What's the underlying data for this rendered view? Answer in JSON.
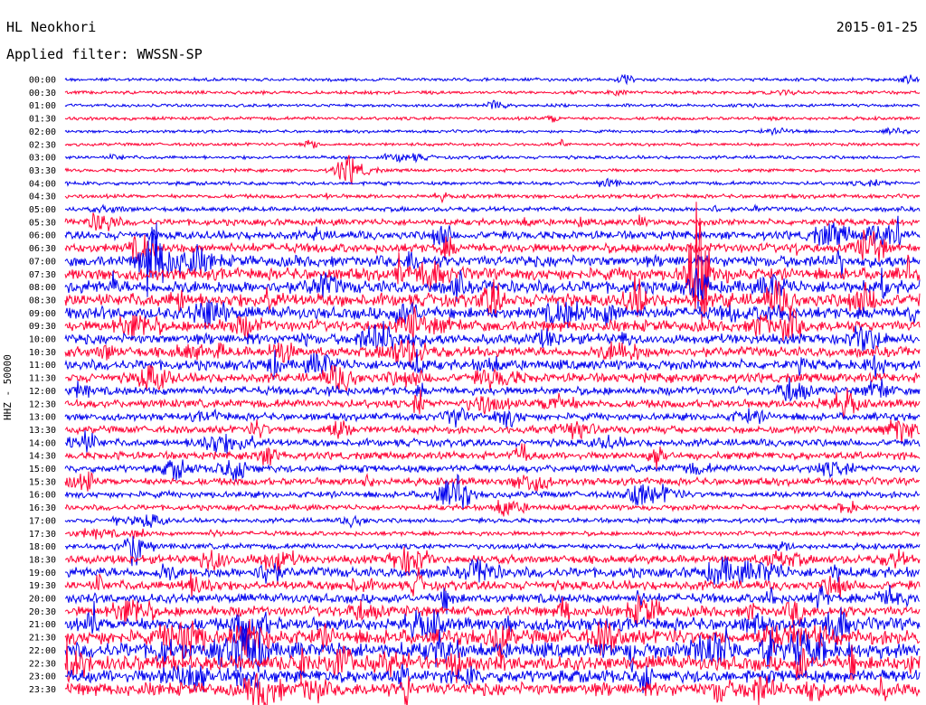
{
  "header": {
    "station": "HL Neokhori",
    "date": "2015-01-25",
    "filter": "Applied filter: WWSSN-SP",
    "channel": "HHZ - 50000"
  },
  "colors": {
    "even_row": "#0000ee",
    "odd_row": "#ff0033",
    "background": "#ffffff"
  },
  "chart_data": {
    "type": "line",
    "title": "",
    "xlabel": "",
    "ylabel": "HHZ - 50000",
    "grid": false,
    "row_labels": [
      "00:00",
      "00:30",
      "01:00",
      "01:30",
      "02:00",
      "02:30",
      "03:00",
      "03:30",
      "04:00",
      "04:30",
      "05:00",
      "05:30",
      "06:00",
      "06:30",
      "07:00",
      "07:30",
      "08:00",
      "08:30",
      "09:00",
      "09:30",
      "10:00",
      "10:30",
      "11:00",
      "11:30",
      "12:00",
      "12:30",
      "13:00",
      "13:30",
      "14:00",
      "14:30",
      "15:00",
      "15:30",
      "16:00",
      "16:30",
      "17:00",
      "17:30",
      "18:00",
      "18:30",
      "19:00",
      "19:30",
      "20:00",
      "20:30",
      "21:00",
      "21:30",
      "22:00",
      "22:30",
      "23:00",
      "23:30"
    ],
    "activity_level": [
      0.08,
      0.08,
      0.07,
      0.08,
      0.06,
      0.07,
      0.08,
      0.08,
      0.1,
      0.12,
      0.15,
      0.25,
      0.35,
      0.4,
      0.5,
      0.55,
      0.6,
      0.6,
      0.55,
      0.5,
      0.45,
      0.45,
      0.45,
      0.4,
      0.35,
      0.35,
      0.3,
      0.3,
      0.3,
      0.3,
      0.3,
      0.3,
      0.25,
      0.2,
      0.15,
      0.15,
      0.2,
      0.35,
      0.45,
      0.4,
      0.4,
      0.45,
      0.6,
      0.7,
      0.75,
      0.7,
      0.6,
      0.6
    ]
  }
}
